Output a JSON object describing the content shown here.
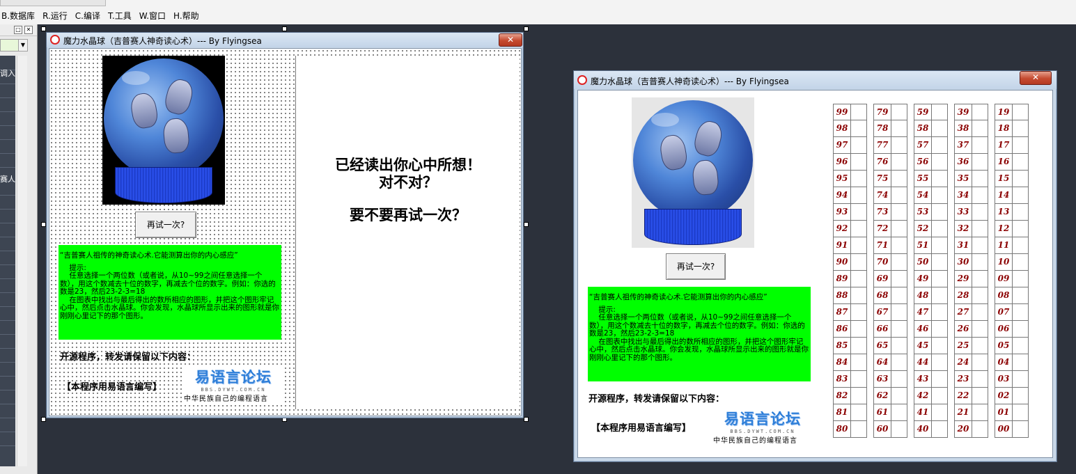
{
  "menubar": {
    "items": [
      "B.数据库",
      "R.运行",
      "C.编译",
      "T.工具",
      "W.窗口",
      "H.帮助"
    ]
  },
  "left_panel": {
    "text1": "调入",
    "text2": "赛人"
  },
  "window_title": "魔力水晶球（吉普赛人神奇读心术）--- By Flyingsea",
  "close_label": "✕",
  "retry_button": "再试一次?",
  "green_text": {
    "heading": "“吉普赛人祖传的神奇读心术.它能测算出你的内心感应”",
    "hint_label": "    提示:",
    "body": "    任意选择一个两位数（或者说，从10~99之间任意选择一个数），用这个数减去十位的数字，再减去个位的数字。例如：你选的数是23，然后23-2-3=18\n    在图表中找出与最后得出的数所相应的图形，并把这个图形牢记心中，然后点击水晶球。你会发现，水晶球所显示出来的图形就是你刚刚心里记下的那个图形。"
  },
  "open_source_note": "开源程序，转发请保留以下内容：",
  "written_with": "【本程序用易语言编写】",
  "logo": {
    "big": "易语言论坛",
    "url": "BBS.DYWT.COM.CN",
    "slogan": "中华民族自己的编程语言"
  },
  "result_message": {
    "line1": "已经读出你心中所想！",
    "line2": "对不对？",
    "line3": "要不要再试一次？"
  },
  "number_columns": [
    [
      "99",
      "98",
      "97",
      "96",
      "95",
      "94",
      "93",
      "92",
      "91",
      "90",
      "89",
      "88",
      "87",
      "86",
      "85",
      "84",
      "83",
      "82",
      "81",
      "80"
    ],
    [
      "79",
      "78",
      "77",
      "76",
      "75",
      "74",
      "73",
      "72",
      "71",
      "70",
      "69",
      "68",
      "67",
      "66",
      "65",
      "64",
      "63",
      "62",
      "61",
      "60"
    ],
    [
      "59",
      "58",
      "57",
      "56",
      "55",
      "54",
      "53",
      "52",
      "51",
      "50",
      "49",
      "48",
      "47",
      "46",
      "45",
      "44",
      "43",
      "42",
      "41",
      "40"
    ],
    [
      "39",
      "38",
      "37",
      "36",
      "35",
      "34",
      "33",
      "32",
      "31",
      "30",
      "29",
      "28",
      "27",
      "26",
      "25",
      "24",
      "23",
      "22",
      "21",
      "20"
    ],
    [
      "19",
      "18",
      "17",
      "16",
      "15",
      "14",
      "13",
      "12",
      "11",
      "10",
      "09",
      "08",
      "07",
      "06",
      "05",
      "04",
      "03",
      "02",
      "01",
      "00"
    ]
  ]
}
